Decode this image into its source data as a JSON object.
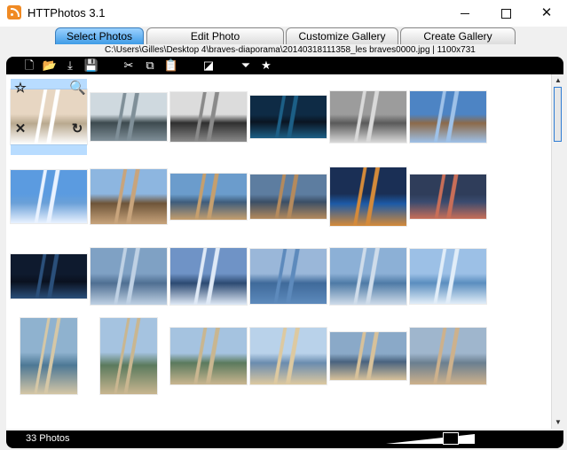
{
  "window": {
    "title": "HTTPhotos 3.1",
    "min": "",
    "max": "",
    "close": "✕"
  },
  "tabs": [
    {
      "label": "Select Photos",
      "active": true
    },
    {
      "label": "Edit Photo",
      "active": false
    },
    {
      "label": "Customize Gallery",
      "active": false
    },
    {
      "label": "Create Gallery",
      "active": false
    }
  ],
  "path": "C:\\Users\\Gilles\\Desktop 4\\braves-diaporama\\20140318111358_les braves0000.jpg | 1100x731",
  "toolbar": {
    "new": "🗋",
    "open": "📂",
    "import": "⤓",
    "save": "💾",
    "cut": "✂",
    "copy": "⧉",
    "paste": "📋",
    "contrast": "◪",
    "filter": "⏷",
    "favorites": "★"
  },
  "overlay": {
    "star": "☆",
    "zoom": "🔍",
    "delete": "✕",
    "rotate": "↻"
  },
  "status": {
    "count": "33 Photos"
  },
  "photos": [
    {
      "name": "braves-0000",
      "colors": [
        "#e7d6c2",
        "#ffffff",
        "#b9a98f"
      ]
    },
    {
      "name": "braves-0001",
      "colors": [
        "#cfd9df",
        "#7f8f98",
        "#3d4a4f"
      ]
    },
    {
      "name": "braves-0002",
      "colors": [
        "#dcdcdc",
        "#8a8a8a",
        "#2f2f2f"
      ]
    },
    {
      "name": "braves-0003",
      "colors": [
        "#0e2b45",
        "#1c5f86",
        "#0a1522"
      ]
    },
    {
      "name": "braves-0004",
      "colors": [
        "#9c9c9c",
        "#d9d9d9",
        "#5a5a5a"
      ]
    },
    {
      "name": "braves-0005",
      "colors": [
        "#4d84c4",
        "#9ec1e8",
        "#8c6a4a"
      ]
    },
    {
      "name": "braves-0006",
      "colors": [
        "#5b9be0",
        "#e9f2ff",
        "#6aa0d8"
      ]
    },
    {
      "name": "braves-0007",
      "colors": [
        "#8db6e0",
        "#c8a47c",
        "#6e5539"
      ]
    },
    {
      "name": "braves-0008",
      "colors": [
        "#6b9ccc",
        "#c59f6e",
        "#3f5d7c"
      ]
    },
    {
      "name": "braves-0009",
      "colors": [
        "#5d7da0",
        "#b48a5d",
        "#3b4f66"
      ]
    },
    {
      "name": "braves-0010",
      "colors": [
        "#1a2f55",
        "#d48a3a",
        "#1c5aa6"
      ]
    },
    {
      "name": "braves-0011",
      "colors": [
        "#2f3d5a",
        "#c86e58",
        "#3a4b6f"
      ]
    },
    {
      "name": "braves-0012",
      "colors": [
        "#0e1a2e",
        "#2a4f7a",
        "#0a111f"
      ]
    },
    {
      "name": "braves-0013",
      "colors": [
        "#7fa1c4",
        "#bfd1e4",
        "#4f6f92"
      ]
    },
    {
      "name": "braves-0014",
      "colors": [
        "#6f93c6",
        "#dfe9f6",
        "#2c4a72"
      ]
    },
    {
      "name": "braves-0015",
      "colors": [
        "#9ab7d9",
        "#5d8abc",
        "#3f6a9a"
      ]
    },
    {
      "name": "braves-0016",
      "colors": [
        "#8cb0d6",
        "#cfdcea",
        "#4e7aa6"
      ]
    },
    {
      "name": "braves-0017",
      "colors": [
        "#9cc0e6",
        "#e1edf8",
        "#5a8ebf"
      ]
    },
    {
      "name": "braves-0018",
      "colors": [
        "#8fb2cf",
        "#d5c7a6",
        "#4d7895"
      ]
    },
    {
      "name": "braves-0019",
      "colors": [
        "#a5c3e0",
        "#c9b690",
        "#5b7a5d"
      ]
    },
    {
      "name": "braves-0020",
      "colors": [
        "#a5c3e0",
        "#c9b690",
        "#5b7a5d"
      ]
    },
    {
      "name": "braves-0021",
      "colors": [
        "#b9d2ea",
        "#ddc9a0",
        "#6a8caf"
      ]
    },
    {
      "name": "braves-0022",
      "colors": [
        "#8aa9c8",
        "#d7c19a",
        "#49637f"
      ]
    },
    {
      "name": "braves-0023",
      "colors": [
        "#9fb6cd",
        "#cdb18c",
        "#6b7f90"
      ]
    },
    {
      "name": "braves-0024",
      "colors": [
        "#c6d8ea",
        "#d9c29c",
        "#7b8da0"
      ]
    }
  ]
}
